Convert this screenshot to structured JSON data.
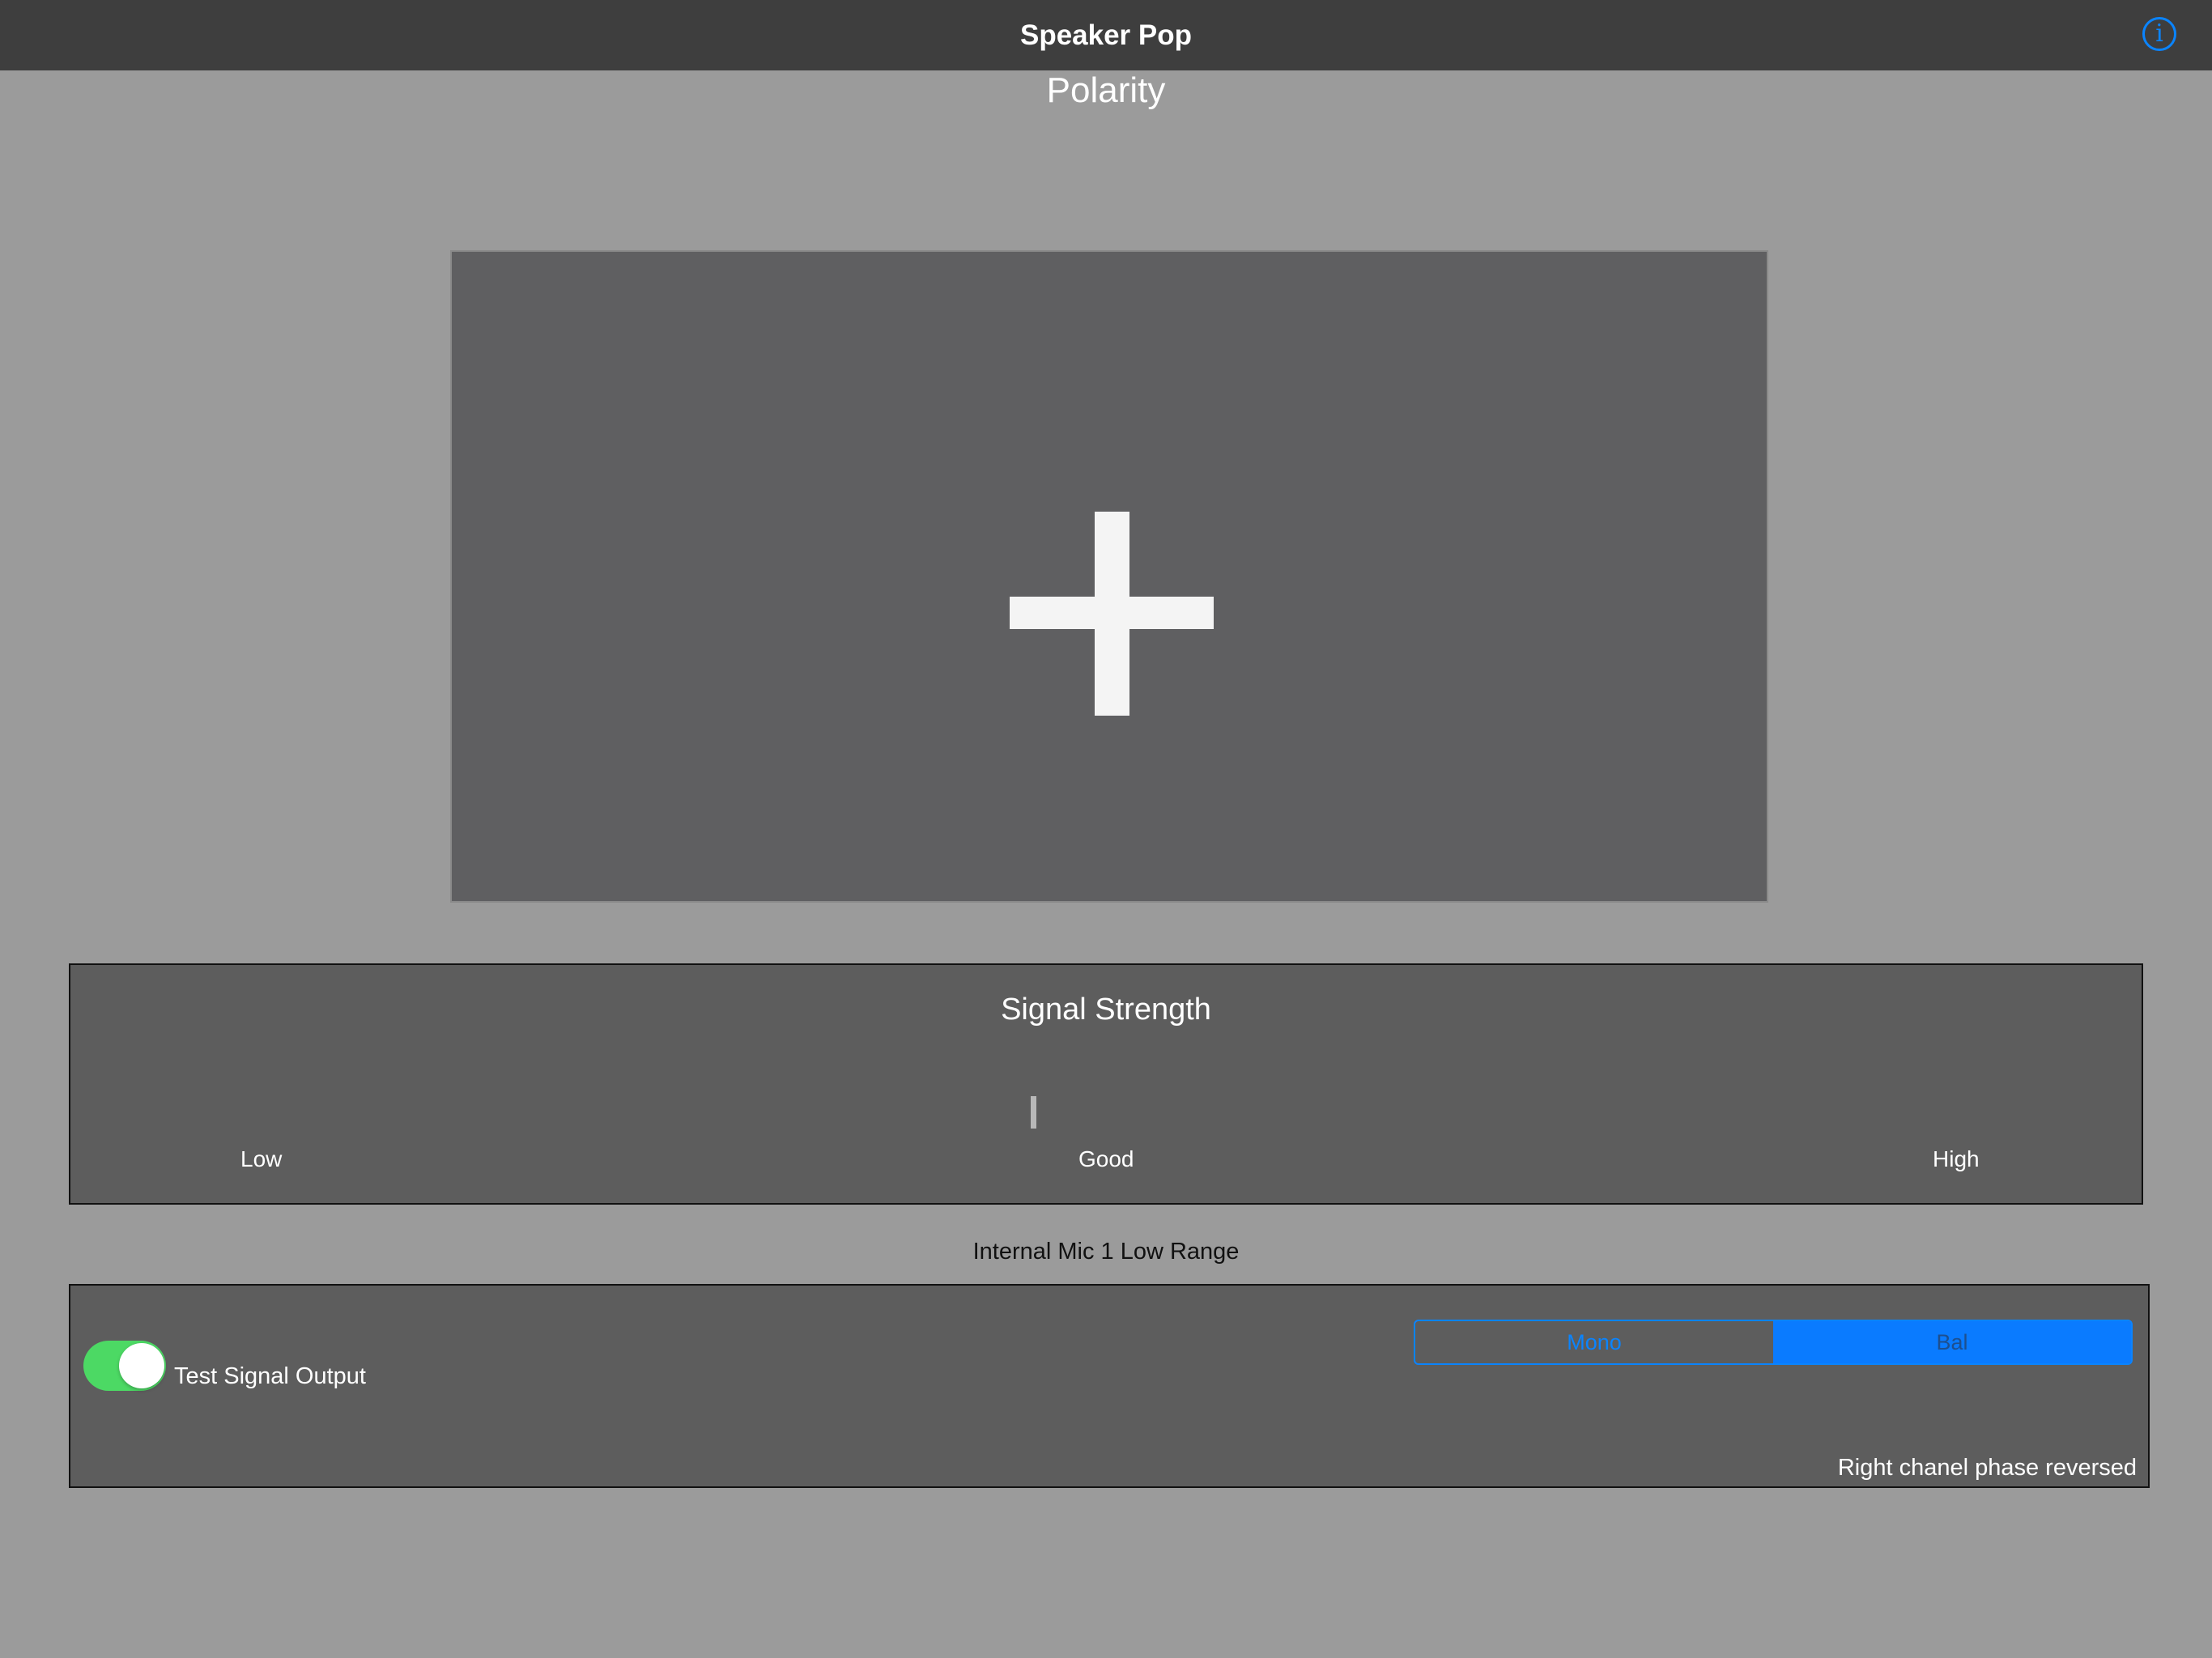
{
  "navbar": {
    "title": "Speaker Pop",
    "info_icon": "info-circle-icon",
    "info_glyph": "i"
  },
  "heading": "Polarity",
  "polarity_display": {
    "symbol": "plus-icon"
  },
  "signal_strength": {
    "title": "Signal Strength",
    "labels": {
      "low": "Low",
      "good": "Good",
      "high": "High"
    }
  },
  "mic": {
    "label": "Internal Mic 1 Low Range"
  },
  "controls": {
    "toggle": {
      "label": "Test Signal Output",
      "on": true
    },
    "segments": [
      {
        "label": "Mono",
        "selected": false
      },
      {
        "label": "Bal",
        "selected": true
      }
    ],
    "status": "Right chanel phase reversed"
  },
  "colors": {
    "accent": "#0a84ff",
    "toggle_on": "#4cd964"
  }
}
